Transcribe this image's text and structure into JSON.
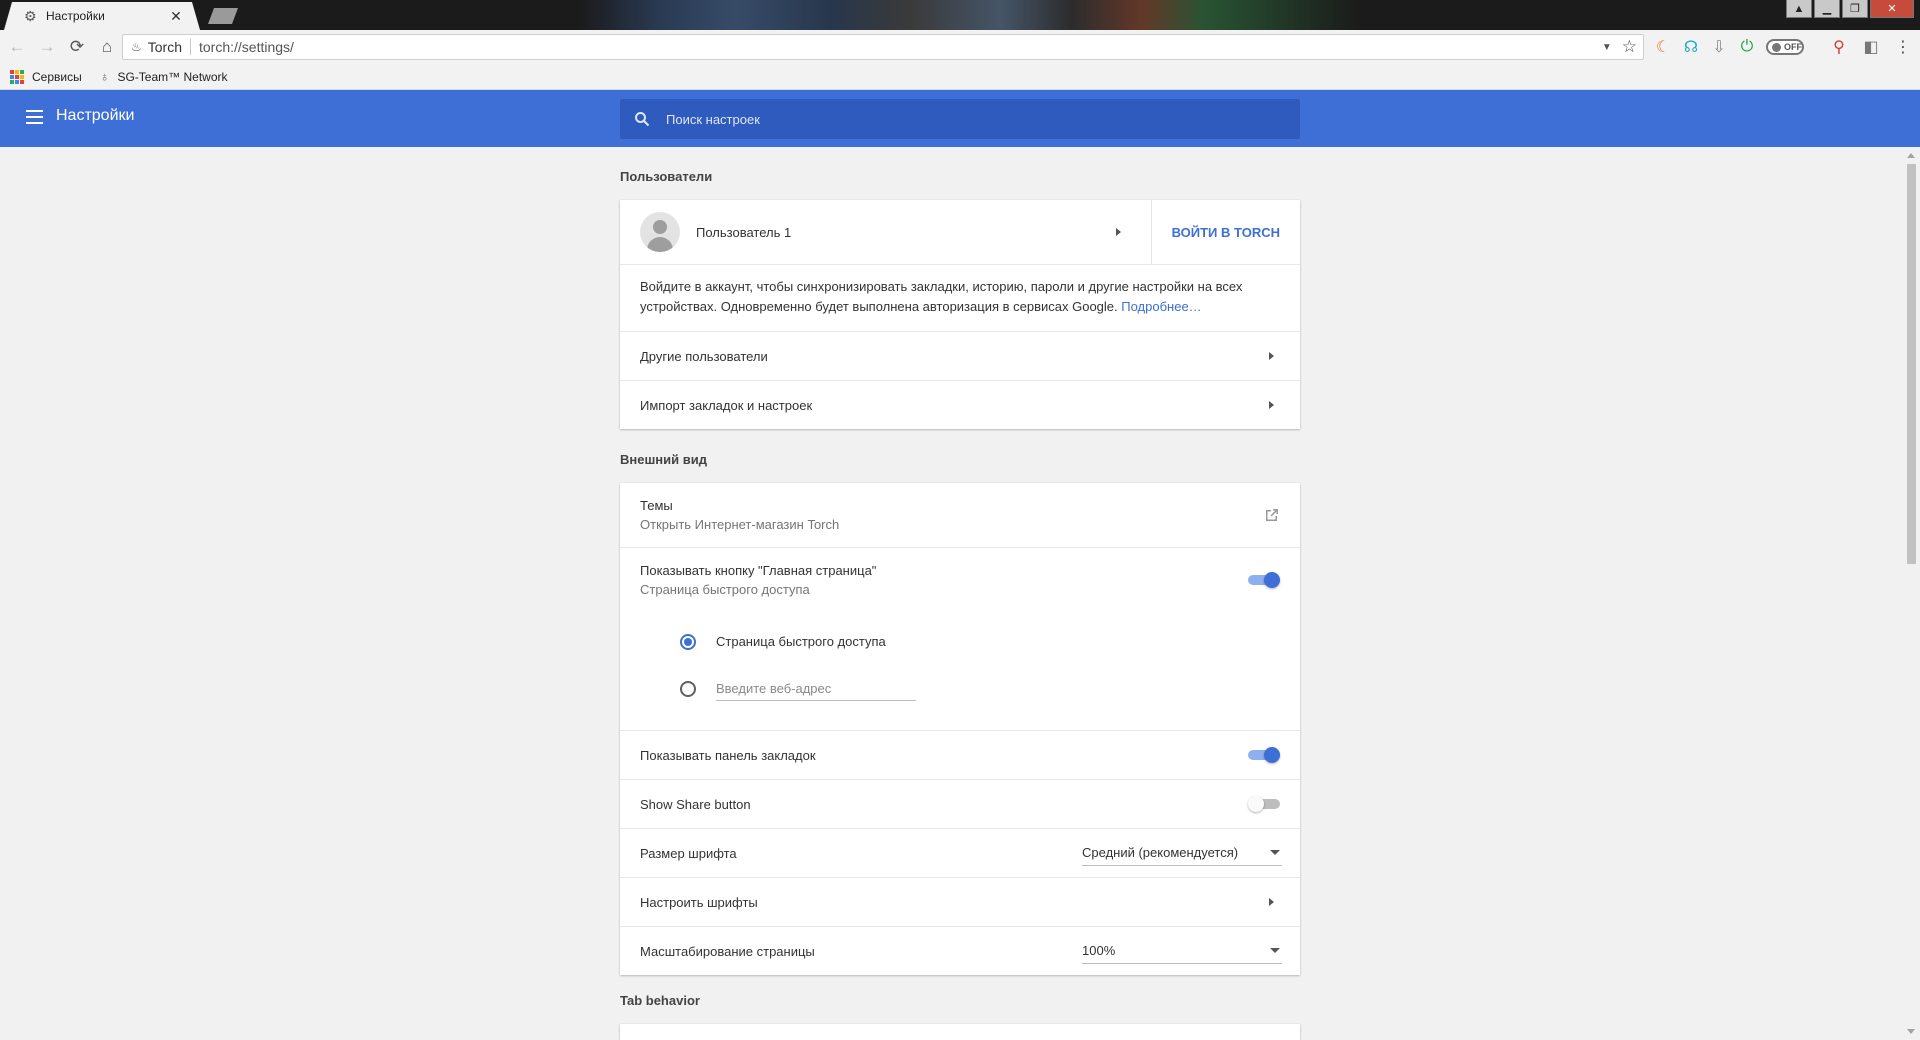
{
  "browser": {
    "tab_title": "Настройки",
    "tab_close": "✕",
    "site_name": "Torch",
    "url": "torch://settings/",
    "ext_off_label": "OFF"
  },
  "bookmarks": {
    "apps": "Сервисы",
    "sg_team": "SG-Team™ Network"
  },
  "header": {
    "title": "Настройки",
    "search_placeholder": "Поиск настроек"
  },
  "users": {
    "section_title": "Пользователи",
    "user_name": "Пользователь 1",
    "signin_button": "ВОЙТИ В TORCH",
    "signin_text": "Войдите в аккаунт, чтобы синхронизировать закладки, историю, пароли и другие настройки на всех устройствах. Одновременно будет выполнена авторизация в сервисах Google.",
    "signin_link": "Подробнее…",
    "other_users": "Другие пользователи",
    "import": "Импорт закладок и настроек"
  },
  "appearance": {
    "section_title": "Внешний вид",
    "themes_label": "Темы",
    "themes_sub": "Открыть Интернет-магазин Torch",
    "home_button_label": "Показывать кнопку \"Главная страница\"",
    "home_button_sub": "Страница быстрого доступа",
    "home_button_on": true,
    "radio_quick_access": "Страница быстрого доступа",
    "radio_url_placeholder": "Введите веб-адрес",
    "bookmarks_bar_label": "Показывать панель закладок",
    "bookmarks_bar_on": true,
    "share_button_label": "Show Share button",
    "share_button_on": false,
    "font_size_label": "Размер шрифта",
    "font_size_value": "Средний (рекомендуется)",
    "customize_fonts": "Настроить шрифты",
    "zoom_label": "Масштабирование страницы",
    "zoom_value": "100%"
  },
  "tab_behavior": {
    "section_title": "Tab behavior"
  },
  "colors": {
    "accent": "#3d6fd6",
    "search_bg": "#2e5bbd"
  }
}
